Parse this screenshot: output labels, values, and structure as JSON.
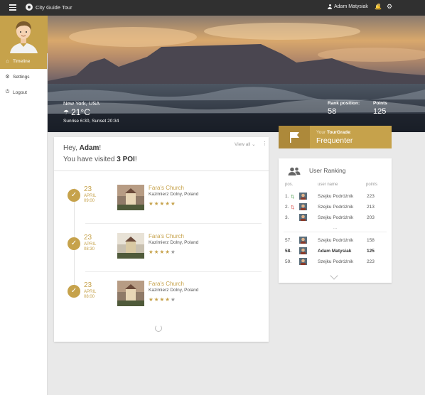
{
  "app": {
    "brand": "City Guide Tour",
    "user_name": "Adam Matysiak"
  },
  "nav": [
    {
      "label": "Timeline",
      "icon": "home-icon",
      "glyph": "⌂",
      "active": true
    },
    {
      "label": "Settings",
      "icon": "gear-icon",
      "glyph": "⚙",
      "active": false
    },
    {
      "label": "Logout",
      "icon": "power-icon",
      "glyph": "⏻",
      "active": false
    }
  ],
  "hero": {
    "location": "New York, USA",
    "temperature": "21°C",
    "sun": "Sunrise 6:30, Sunset 20:34",
    "rank_label": "Rank position:",
    "rank_value": "58",
    "points_label": "Points",
    "points_value": "125"
  },
  "timeline": {
    "greeting_prefix": "Hey, ",
    "greeting_name": "Adam",
    "greeting_suffix": "!",
    "visited_prefix": "You have visited ",
    "visited_count": "3 POI",
    "visited_suffix": "!",
    "view_all": "View all",
    "entries": [
      {
        "day": "23",
        "month": "APRIL",
        "time": "09:00",
        "title": "Fara's Church",
        "place": "Kazimierz Dolny, Poland",
        "rating": 5
      },
      {
        "day": "23",
        "month": "APRIL",
        "time": "08:30",
        "title": "Fara's Church",
        "place": "Kazimierz Dolny, Poland",
        "rating": 4
      },
      {
        "day": "23",
        "month": "APRIL",
        "time": "08:00",
        "title": "Fara's Church",
        "place": "Kazimierz Dolny, Poland",
        "rating": 4
      }
    ]
  },
  "grade": {
    "label_prefix": "Your ",
    "label_bold": "TourGrade",
    "label_suffix": ":",
    "value": "Frequenter"
  },
  "ranking": {
    "title": "User Ranking",
    "headers": {
      "pos": "pos.",
      "user": "user name",
      "points": "points"
    },
    "rows": [
      {
        "pos": "1.",
        "trend": "up",
        "name": "Szejku Podróżnik",
        "points": "223",
        "me": false
      },
      {
        "pos": "2.",
        "trend": "down",
        "name": "Szejku Podróżnik",
        "points": "213",
        "me": false
      },
      {
        "pos": "3.",
        "trend": "",
        "name": "Szejku Podróżnik",
        "points": "203",
        "me": false
      },
      {
        "pos": "57.",
        "trend": "",
        "name": "Szejku Podróżnik",
        "points": "158",
        "me": false
      },
      {
        "pos": "58.",
        "trend": "",
        "name": "Adam Matysiak",
        "points": "125",
        "me": true
      },
      {
        "pos": "59.",
        "trend": "",
        "name": "Szejku Podróżnik",
        "points": "223",
        "me": false
      }
    ],
    "ellipsis": "...",
    "colors": {
      "up": "#5aa35a",
      "down": "#d9534f"
    }
  },
  "colors": {
    "accent": "#c6a24b",
    "topbar": "#303030"
  }
}
